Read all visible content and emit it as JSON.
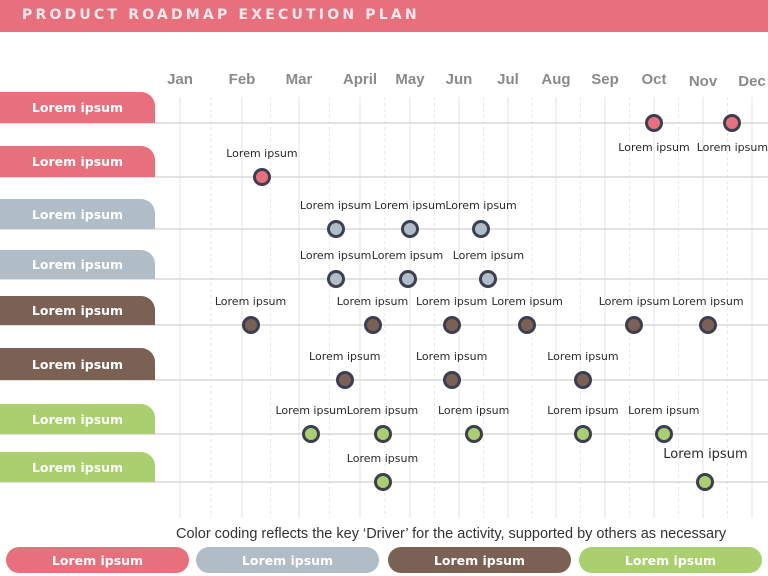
{
  "header": {
    "title": "PRODUCT ROADMAP EXECUTION PLAN"
  },
  "colors": {
    "pink": "#e8707d",
    "gray": "#b0bcc6",
    "brown": "#7a6153",
    "green": "#a9cf6e",
    "marker_border": "#3b3f52"
  },
  "months": [
    "Jan",
    "Feb",
    "Mar",
    "April",
    "May",
    "Jun",
    "Jul",
    "Aug",
    "Sep",
    "Oct",
    "Nov",
    "Dec"
  ],
  "rows": [
    {
      "label": "Lorem ipsum",
      "color": "pink",
      "milestones": [
        {
          "month_index": 9.0,
          "label": "Lorem ipsum",
          "label_pos": "below"
        },
        {
          "month_index": 10.6,
          "label": "Lorem ipsum",
          "label_pos": "below"
        }
      ]
    },
    {
      "label": "Lorem ipsum",
      "color": "pink",
      "milestones": [
        {
          "month_index": 1.35,
          "label": "Lorem ipsum",
          "label_pos": "above"
        }
      ]
    },
    {
      "label": "Lorem ipsum",
      "color": "gray",
      "milestones": [
        {
          "month_index": 2.6,
          "label": "Lorem ipsum",
          "label_pos": "above"
        },
        {
          "month_index": 4.0,
          "label": "Lorem ipsum",
          "label_pos": "above"
        },
        {
          "month_index": 5.45,
          "label": "Lorem ipsum",
          "label_pos": "above"
        }
      ]
    },
    {
      "label": "Lorem ipsum",
      "color": "gray",
      "milestones": [
        {
          "month_index": 2.6,
          "label": "Lorem ipsum",
          "label_pos": "above"
        },
        {
          "month_index": 3.95,
          "label": "Lorem ipsum",
          "label_pos": "above"
        },
        {
          "month_index": 5.6,
          "label": "Lorem ipsum",
          "label_pos": "above"
        }
      ]
    },
    {
      "label": "Lorem ipsum",
      "color": "brown",
      "milestones": [
        {
          "month_index": 1.15,
          "label": "Lorem ipsum",
          "label_pos": "above"
        },
        {
          "month_index": 3.25,
          "label": "Lorem ipsum",
          "label_pos": "above"
        },
        {
          "month_index": 4.85,
          "label": "Lorem ipsum",
          "label_pos": "above"
        },
        {
          "month_index": 6.4,
          "label": "Lorem ipsum",
          "label_pos": "above"
        },
        {
          "month_index": 8.6,
          "label": "Lorem ipsum",
          "label_pos": "above"
        },
        {
          "month_index": 10.1,
          "label": "Lorem ipsum",
          "label_pos": "above"
        }
      ]
    },
    {
      "label": "Lorem ipsum",
      "color": "brown",
      "milestones": [
        {
          "month_index": 2.75,
          "label": "Lorem ipsum",
          "label_pos": "above"
        },
        {
          "month_index": 4.85,
          "label": "Lorem ipsum",
          "label_pos": "above"
        },
        {
          "month_index": 7.55,
          "label": "Lorem ipsum",
          "label_pos": "above"
        }
      ]
    },
    {
      "label": "Lorem ipsum",
      "color": "green",
      "milestones": [
        {
          "month_index": 2.2,
          "label": "Lorem ipsum",
          "label_pos": "above"
        },
        {
          "month_index": 3.45,
          "label": "Lorem ipsum",
          "label_pos": "above"
        },
        {
          "month_index": 5.3,
          "label": "Lorem ipsum",
          "label_pos": "above"
        },
        {
          "month_index": 7.55,
          "label": "Lorem ipsum",
          "label_pos": "above"
        },
        {
          "month_index": 9.2,
          "label": "Lorem ipsum",
          "label_pos": "above"
        }
      ]
    },
    {
      "label": "Lorem ipsum",
      "color": "green",
      "milestones": [
        {
          "month_index": 3.45,
          "label": "Lorem ipsum",
          "label_pos": "above"
        },
        {
          "month_index": 10.05,
          "label": "Lorem ipsum",
          "label_pos": "above",
          "emphasis": true
        }
      ]
    }
  ],
  "footnote": "Color coding reflects the key ‘Driver’ for the activity, supported by others as necessary",
  "legend": [
    {
      "label": "Lorem ipsum",
      "color": "pink"
    },
    {
      "label": "Lorem ipsum",
      "color": "gray"
    },
    {
      "label": "Lorem ipsum",
      "color": "brown"
    },
    {
      "label": "Lorem ipsum",
      "color": "green"
    }
  ]
}
